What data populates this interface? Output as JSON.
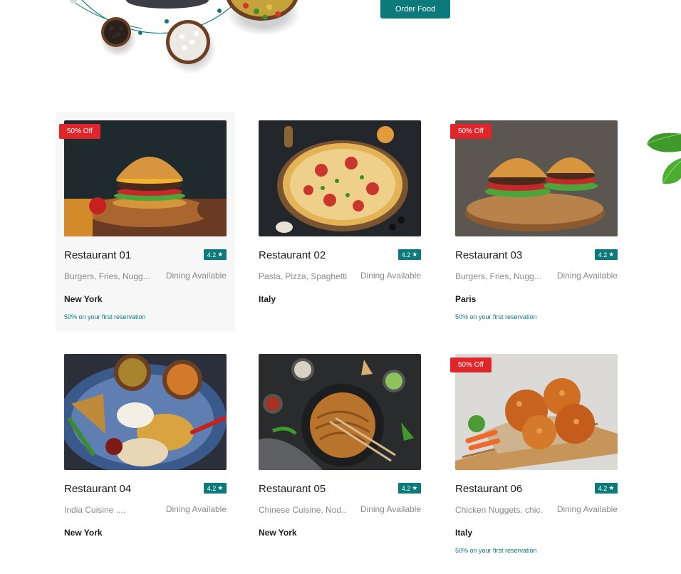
{
  "hero": {
    "order_button": "Order Food"
  },
  "restaurants": [
    {
      "name": "Restaurant 01",
      "rating": "4.2",
      "cuisine": "Burgers, Fries, Nugg...",
      "dining": "Dining Available",
      "city": "New York",
      "badge": "50% Off",
      "promo": "50% on your first reservation",
      "image": "burger-image"
    },
    {
      "name": "Restaurant 02",
      "rating": "4.2",
      "cuisine": "Pasta, Pizza, Spaghetti..",
      "dining": "Dining Available",
      "city": "Italy",
      "badge": "",
      "promo": "",
      "image": "pizza-image"
    },
    {
      "name": "Restaurant 03",
      "rating": "4.2",
      "cuisine": "Burgers, Fries, Nugg...",
      "dining": "Dining Available",
      "city": "Paris",
      "badge": "50% Off",
      "promo": "50% on your first reservation",
      "image": "burgers-image"
    },
    {
      "name": "Restaurant 04",
      "rating": "4.2",
      "cuisine": "India Cuisine ....",
      "dining": "Dining Available",
      "city": "New York",
      "badge": "",
      "promo": "",
      "image": "indian-food-image"
    },
    {
      "name": "Restaurant 05",
      "rating": "4.2",
      "cuisine": "Chinese Cuisine, Nod...",
      "dining": "Dining Available",
      "city": "New York",
      "badge": "",
      "promo": "",
      "image": "noodles-image"
    },
    {
      "name": "Restaurant 06",
      "rating": "4.2",
      "cuisine": "Chicken Nuggets, chic...",
      "dining": "Dining Available",
      "city": "Italy",
      "badge": "50% Off",
      "promo": "50% on your first reservation",
      "image": "fried-chicken-image"
    }
  ],
  "colors": {
    "accent": "#0c7a7a",
    "badge": "#e0262b",
    "card_hover": "#f7f7f7"
  }
}
